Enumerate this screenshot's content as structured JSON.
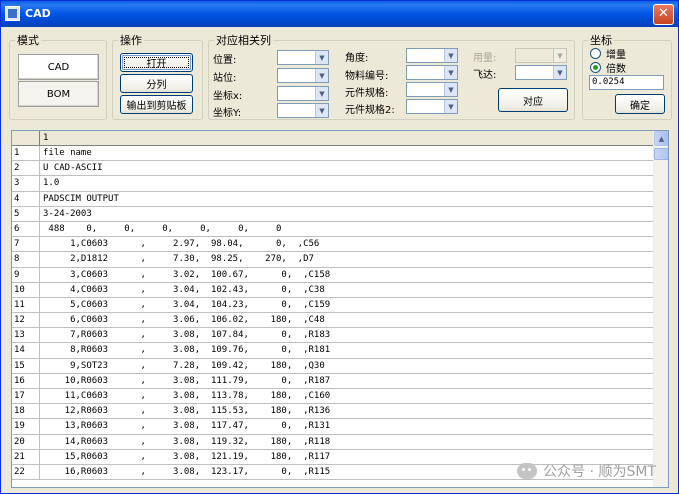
{
  "window": {
    "title": "CAD",
    "close_label": "✕"
  },
  "mode": {
    "legend": "模式",
    "cad_label": "CAD",
    "bom_label": "BOM"
  },
  "ops": {
    "legend": "操作",
    "open_label": "打开",
    "split_label": "分列",
    "export_label": "输出到剪贴板"
  },
  "map": {
    "legend": "对应相关列",
    "position_label": "位置:",
    "station_label": "站位:",
    "coordx_label": "坐标x:",
    "coordy_label": "坐标Y:",
    "angle_label": "角度:",
    "material_label": "物料编号:",
    "spec1_label": "元件规格:",
    "spec2_label": "元件规格2:",
    "qty_label": "用量:",
    "feeder_label": "飞达:",
    "match_label": "对应"
  },
  "coords": {
    "legend": "坐标",
    "increment_label": "增量",
    "multiple_label": "倍数",
    "value": "0.0254",
    "ok_label": "确定"
  },
  "grid": {
    "header": "1",
    "rows": [
      {
        "n": "1",
        "v": "file name"
      },
      {
        "n": "2",
        "v": "U CAD-ASCII"
      },
      {
        "n": "3",
        "v": "1.0"
      },
      {
        "n": "4",
        "v": "PADSCIM OUTPUT"
      },
      {
        "n": "5",
        "v": "3-24-2003"
      },
      {
        "n": "6",
        "v": " 488    0,     0,     0,     0,     0,     0"
      },
      {
        "n": "7",
        "v": "     1,C0603      ,     2.97,  98.04,      0,  ,C56"
      },
      {
        "n": "8",
        "v": "     2,D1812      ,     7.30,  98.25,    270,  ,D7"
      },
      {
        "n": "9",
        "v": "     3,C0603      ,     3.02,  100.67,      0,  ,C158"
      },
      {
        "n": "10",
        "v": "     4,C0603      ,     3.04,  102.43,      0,  ,C38"
      },
      {
        "n": "11",
        "v": "     5,C0603      ,     3.04,  104.23,      0,  ,C159"
      },
      {
        "n": "12",
        "v": "     6,C0603      ,     3.06,  106.02,    180,  ,C48"
      },
      {
        "n": "13",
        "v": "     7,R0603      ,     3.08,  107.84,      0,  ,R183"
      },
      {
        "n": "14",
        "v": "     8,R0603      ,     3.08,  109.76,      0,  ,R181"
      },
      {
        "n": "15",
        "v": "     9,SOT23      ,     7.28,  109.42,    180,  ,Q30"
      },
      {
        "n": "16",
        "v": "    10,R0603      ,     3.08,  111.79,      0,  ,R187"
      },
      {
        "n": "17",
        "v": "    11,C0603      ,     3.08,  113.78,    180,  ,C160"
      },
      {
        "n": "18",
        "v": "    12,R0603      ,     3.08,  115.53,    180,  ,R136"
      },
      {
        "n": "19",
        "v": "    13,R0603      ,     3.08,  117.47,      0,  ,R131"
      },
      {
        "n": "20",
        "v": "    14,R0603      ,     3.08,  119.32,    180,  ,R118"
      },
      {
        "n": "21",
        "v": "    15,R0603      ,     3.08,  121.19,    180,  ,R117"
      },
      {
        "n": "22",
        "v": "    16,R0603      ,     3.08,  123.17,      0,  ,R115"
      }
    ]
  },
  "watermark": {
    "text": "公众号 · 顺为SMT"
  }
}
